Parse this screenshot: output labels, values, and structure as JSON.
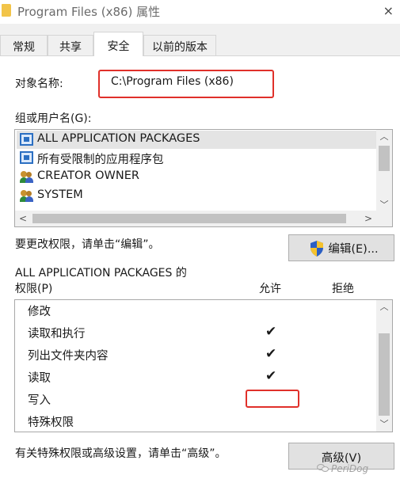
{
  "window": {
    "title": "Program Files (x86) 属性",
    "close_glyph": "×"
  },
  "tabs": [
    {
      "label": "常规"
    },
    {
      "label": "共享"
    },
    {
      "label": "安全"
    },
    {
      "label": "以前的版本"
    }
  ],
  "active_tab": "安全",
  "object": {
    "label": "对象名称:",
    "value": "C:\\Program Files (x86)"
  },
  "groups": {
    "label": "组或用户名(G):",
    "items": [
      {
        "label": "ALL APPLICATION PACKAGES",
        "icon": "package-group-icon"
      },
      {
        "label": "所有受限制的应用程序包",
        "icon": "package-group-icon"
      },
      {
        "label": "CREATOR OWNER",
        "icon": "user-group-icon"
      },
      {
        "label": "SYSTEM",
        "icon": "user-group-icon"
      }
    ],
    "selected": "ALL APPLICATION PACKAGES"
  },
  "edit": {
    "hint": "要更改权限，请单击“编辑”。",
    "button_label": "编辑(E)..."
  },
  "permissions": {
    "title_line1": "ALL APPLICATION PACKAGES 的",
    "title_line2": "权限(P)",
    "allow_header": "允许",
    "deny_header": "拒绝",
    "rows": [
      {
        "label": "修改",
        "allow": false,
        "deny": false
      },
      {
        "label": "读取和执行",
        "allow": true,
        "deny": false
      },
      {
        "label": "列出文件夹内容",
        "allow": true,
        "deny": false
      },
      {
        "label": "读取",
        "allow": true,
        "deny": false
      },
      {
        "label": "写入",
        "allow": false,
        "deny": false
      },
      {
        "label": "特殊权限",
        "allow": false,
        "deny": false
      }
    ],
    "check_glyph": "✔"
  },
  "advanced": {
    "hint": "有关特殊权限或高级设置，请单击“高级”。",
    "button_label": "高级(V)"
  },
  "watermark": "PeriDog",
  "colors": {
    "highlight_red": "#e0302a",
    "selection": "#e4e4e4",
    "folder": "#f2c449",
    "shield_blue": "#2b5fc4",
    "shield_yellow": "#f5c22c"
  }
}
